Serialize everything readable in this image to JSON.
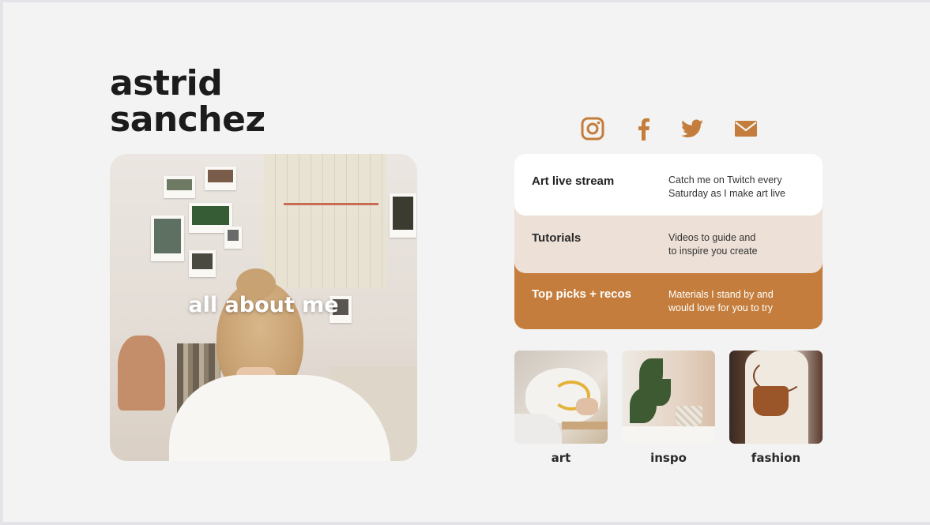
{
  "profile": {
    "name_line1": "astrid",
    "name_line2": "sanchez"
  },
  "about_card": {
    "title": "all about me"
  },
  "socials": [
    {
      "icon": "instagram-icon"
    },
    {
      "icon": "facebook-icon"
    },
    {
      "icon": "twitter-icon"
    },
    {
      "icon": "mail-icon"
    }
  ],
  "links": [
    {
      "title": "Art live stream",
      "desc_line1": "Catch me on Twitch every",
      "desc_line2": "Saturday as I make art live"
    },
    {
      "title": "Tutorials",
      "desc_line1": "Videos to guide and",
      "desc_line2": "to inspire you create"
    },
    {
      "title": "Top picks + recos",
      "desc_line1": "Materials I stand by and",
      "desc_line2": "would love for you to try"
    }
  ],
  "tiles": [
    {
      "label": "art"
    },
    {
      "label": "inspo"
    },
    {
      "label": "fashion"
    }
  ],
  "colors": {
    "accent": "#c47d3c",
    "card_light": "#ffffff",
    "card_beige": "#ede0d7",
    "background": "#f3f3f3",
    "text_dark": "#1c1c1c"
  }
}
